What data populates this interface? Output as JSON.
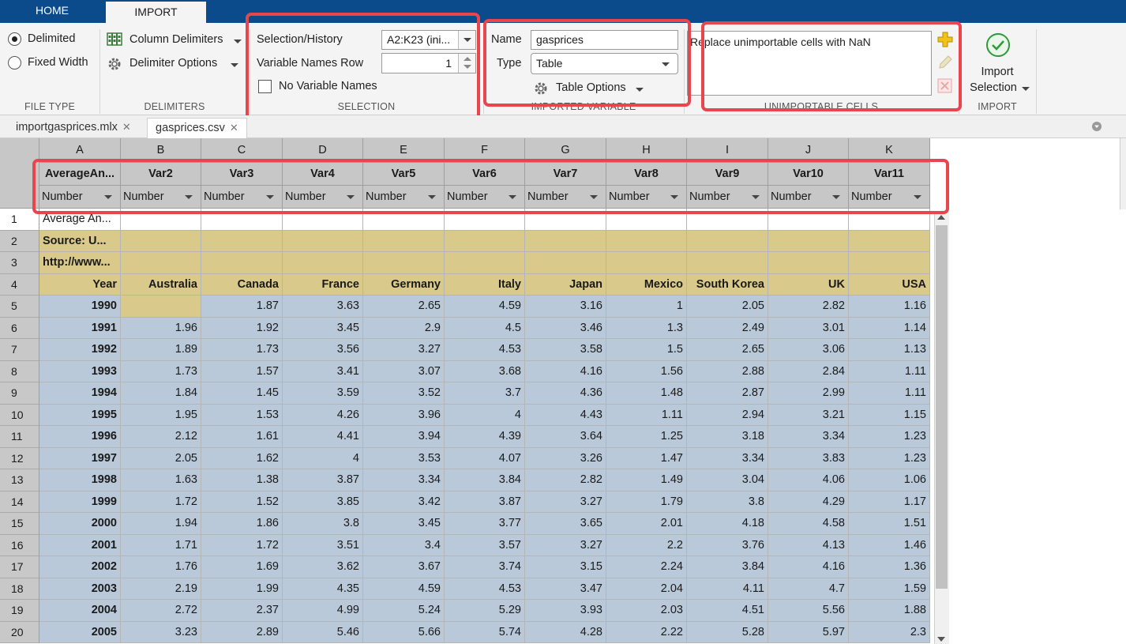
{
  "top_tabs": [
    "HOME",
    "IMPORT"
  ],
  "ribbon": {
    "file_type": {
      "options": [
        "Delimited",
        "Fixed Width"
      ],
      "selected": "Delimited",
      "label": "FILE TYPE"
    },
    "delimiters": {
      "column_delimiters": "Column Delimiters",
      "delimiter_options": "Delimiter Options",
      "label": "DELIMITERS"
    },
    "selection": {
      "history_label": "Selection/History",
      "history_value": "A2:K23 (ini...",
      "var_names_row_label": "Variable Names Row",
      "var_names_row_value": "1",
      "no_var_names_label": "No Variable Names",
      "no_var_names_checked": false,
      "label": "SELECTION"
    },
    "imported_variable": {
      "name_label": "Name",
      "name_value": "gasprices",
      "type_label": "Type",
      "type_value": "Table",
      "table_options": "Table Options",
      "label": "IMPORTED VARIABLE"
    },
    "unimportable": {
      "rule_text": "Replace unimportable cells with NaN",
      "label": "UNIMPORTABLE CELLS"
    },
    "import": {
      "button_line1": "Import",
      "button_line2": "Selection",
      "label": "IMPORT"
    }
  },
  "doc_tabs": [
    "importgasprices.mlx",
    "gasprices.csv"
  ],
  "active_doc_tab": "gasprices.csv",
  "grid": {
    "column_letters": [
      "A",
      "B",
      "C",
      "D",
      "E",
      "F",
      "G",
      "H",
      "I",
      "J",
      "K"
    ],
    "variable_names": [
      "AverageAn...",
      "Var2",
      "Var3",
      "Var4",
      "Var5",
      "Var6",
      "Var7",
      "Var8",
      "Var9",
      "Var10",
      "Var11"
    ],
    "variable_type": "Number",
    "rows": [
      {
        "n": "1",
        "cells": [
          "Average An...",
          "",
          "",
          "",
          "",
          "",
          "",
          "",
          "",
          "",
          ""
        ]
      },
      {
        "n": "2",
        "cells": [
          "Source: U...",
          "",
          "",
          "",
          "",
          "",
          "",
          "",
          "",
          "",
          ""
        ]
      },
      {
        "n": "3",
        "cells": [
          "http://www...",
          "",
          "",
          "",
          "",
          "",
          "",
          "",
          "",
          "",
          ""
        ]
      },
      {
        "n": "4",
        "cells": [
          "Year",
          "Australia",
          "Canada",
          "France",
          "Germany",
          "Italy",
          "Japan",
          "Mexico",
          "South Korea",
          "UK",
          "USA"
        ]
      },
      {
        "n": "5",
        "cells": [
          "1990",
          "",
          "1.87",
          "3.63",
          "2.65",
          "4.59",
          "3.16",
          "1",
          "2.05",
          "2.82",
          "1.16"
        ]
      },
      {
        "n": "6",
        "cells": [
          "1991",
          "1.96",
          "1.92",
          "3.45",
          "2.9",
          "4.5",
          "3.46",
          "1.3",
          "2.49",
          "3.01",
          "1.14"
        ]
      },
      {
        "n": "7",
        "cells": [
          "1992",
          "1.89",
          "1.73",
          "3.56",
          "3.27",
          "4.53",
          "3.58",
          "1.5",
          "2.65",
          "3.06",
          "1.13"
        ]
      },
      {
        "n": "8",
        "cells": [
          "1993",
          "1.73",
          "1.57",
          "3.41",
          "3.07",
          "3.68",
          "4.16",
          "1.56",
          "2.88",
          "2.84",
          "1.11"
        ]
      },
      {
        "n": "9",
        "cells": [
          "1994",
          "1.84",
          "1.45",
          "3.59",
          "3.52",
          "3.7",
          "4.36",
          "1.48",
          "2.87",
          "2.99",
          "1.11"
        ]
      },
      {
        "n": "10",
        "cells": [
          "1995",
          "1.95",
          "1.53",
          "4.26",
          "3.96",
          "4",
          "4.43",
          "1.11",
          "2.94",
          "3.21",
          "1.15"
        ]
      },
      {
        "n": "11",
        "cells": [
          "1996",
          "2.12",
          "1.61",
          "4.41",
          "3.94",
          "4.39",
          "3.64",
          "1.25",
          "3.18",
          "3.34",
          "1.23"
        ]
      },
      {
        "n": "12",
        "cells": [
          "1997",
          "2.05",
          "1.62",
          "4",
          "3.53",
          "4.07",
          "3.26",
          "1.47",
          "3.34",
          "3.83",
          "1.23"
        ]
      },
      {
        "n": "13",
        "cells": [
          "1998",
          "1.63",
          "1.38",
          "3.87",
          "3.34",
          "3.84",
          "2.82",
          "1.49",
          "3.04",
          "4.06",
          "1.06"
        ]
      },
      {
        "n": "14",
        "cells": [
          "1999",
          "1.72",
          "1.52",
          "3.85",
          "3.42",
          "3.87",
          "3.27",
          "1.79",
          "3.8",
          "4.29",
          "1.17"
        ]
      },
      {
        "n": "15",
        "cells": [
          "2000",
          "1.94",
          "1.86",
          "3.8",
          "3.45",
          "3.77",
          "3.65",
          "2.01",
          "4.18",
          "4.58",
          "1.51"
        ]
      },
      {
        "n": "16",
        "cells": [
          "2001",
          "1.71",
          "1.72",
          "3.51",
          "3.4",
          "3.57",
          "3.27",
          "2.2",
          "3.76",
          "4.13",
          "1.46"
        ]
      },
      {
        "n": "17",
        "cells": [
          "2002",
          "1.76",
          "1.69",
          "3.62",
          "3.67",
          "3.74",
          "3.15",
          "2.24",
          "3.84",
          "4.16",
          "1.36"
        ]
      },
      {
        "n": "18",
        "cells": [
          "2003",
          "2.19",
          "1.99",
          "4.35",
          "4.59",
          "4.53",
          "3.47",
          "2.04",
          "4.11",
          "4.7",
          "1.59"
        ]
      },
      {
        "n": "19",
        "cells": [
          "2004",
          "2.72",
          "2.37",
          "4.99",
          "5.24",
          "5.29",
          "3.93",
          "2.03",
          "4.51",
          "5.56",
          "1.88"
        ]
      },
      {
        "n": "20",
        "cells": [
          "2005",
          "3.23",
          "2.89",
          "5.46",
          "5.66",
          "5.74",
          "4.28",
          "2.22",
          "5.28",
          "5.97",
          "2.3"
        ]
      }
    ]
  },
  "colors": {
    "header_bar": "#0b4a8b",
    "highlight": "#e8464f",
    "tan_cells": "#d9c98a",
    "blue_cells": "#b9c9d9"
  }
}
